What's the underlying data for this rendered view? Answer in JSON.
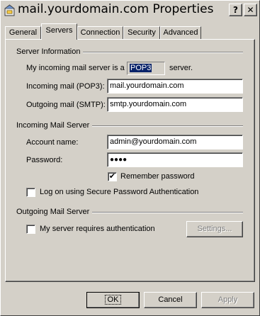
{
  "window": {
    "title": "mail.yourdomain.com Properties",
    "icon": "account-properties-icon",
    "help_button": "?",
    "close_button": "✕"
  },
  "tabs": [
    {
      "label": "General",
      "active": false
    },
    {
      "label": "Servers",
      "active": true
    },
    {
      "label": "Connection",
      "active": false
    },
    {
      "label": "Security",
      "active": false
    },
    {
      "label": "Advanced",
      "active": false
    }
  ],
  "server_info": {
    "group_title": "Server Information",
    "incoming_type_prefix": "My incoming mail server is a",
    "incoming_type_value": "POP3",
    "incoming_type_suffix": "server.",
    "incoming_label": "Incoming mail (POP3):",
    "incoming_value": "mail.yourdomain.com",
    "outgoing_label": "Outgoing mail (SMTP):",
    "outgoing_value": "smtp.yourdomain.com"
  },
  "incoming_server": {
    "group_title": "Incoming Mail Server",
    "account_label": "Account name:",
    "account_value": "admin@yourdomain.com",
    "password_label": "Password:",
    "password_value": "●●●●",
    "remember_label": "Remember password",
    "remember_checked": true,
    "spa_label": "Log on using Secure Password Authentication",
    "spa_checked": false
  },
  "outgoing_server": {
    "group_title": "Outgoing Mail Server",
    "auth_label": "My server requires authentication",
    "auth_checked": false,
    "settings_button": "Settings..."
  },
  "footer": {
    "ok": "OK",
    "cancel": "Cancel",
    "apply": "Apply"
  }
}
